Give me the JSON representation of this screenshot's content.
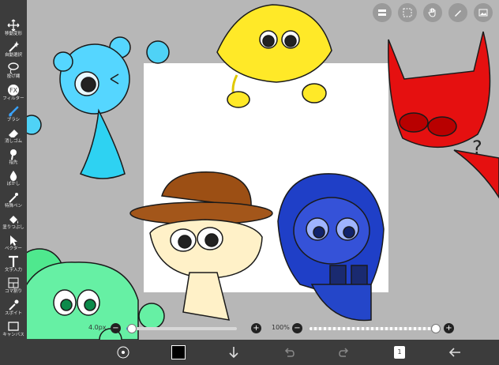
{
  "toolbar": {
    "tools": [
      {
        "label": "移動変形",
        "icon": "move-icon"
      },
      {
        "label": "自動選択",
        "icon": "magic-wand-icon"
      },
      {
        "label": "投げ縄",
        "icon": "lasso-icon"
      },
      {
        "label": "フィルター",
        "icon": "fx-icon"
      },
      {
        "label": "ブラシ",
        "icon": "brush-icon"
      },
      {
        "label": "消しゴム",
        "icon": "eraser-icon"
      },
      {
        "label": "指先",
        "icon": "finger-icon"
      },
      {
        "label": "ぼかし",
        "icon": "blur-icon"
      },
      {
        "label": "特殊ペン",
        "icon": "special-pen-icon"
      },
      {
        "label": "塗りつぶし",
        "icon": "fill-icon"
      },
      {
        "label": "ベクター",
        "icon": "vector-icon"
      },
      {
        "label": "文字入力",
        "icon": "text-icon"
      },
      {
        "label": "コマ割り",
        "icon": "frame-icon"
      },
      {
        "label": "スポイト",
        "icon": "eyedropper-icon"
      },
      {
        "label": "キャンバス",
        "icon": "canvas-icon"
      }
    ],
    "active_index": 4
  },
  "top_tools": [
    "layer-toggle-icon",
    "selection-icon",
    "hand-icon",
    "pen-icon",
    "image-icon"
  ],
  "sliders": {
    "size_label": "4.0px",
    "opacity_label": "100%",
    "size_value": 0.05,
    "opacity_value": 1.0
  },
  "bottombar": {
    "color_hex": "#000000",
    "layer_count": "1"
  },
  "colors": {
    "toolbar_bg": "#3c3c3c",
    "accent": "#3aa3ff",
    "slider_fill": "#2f7fd6"
  }
}
